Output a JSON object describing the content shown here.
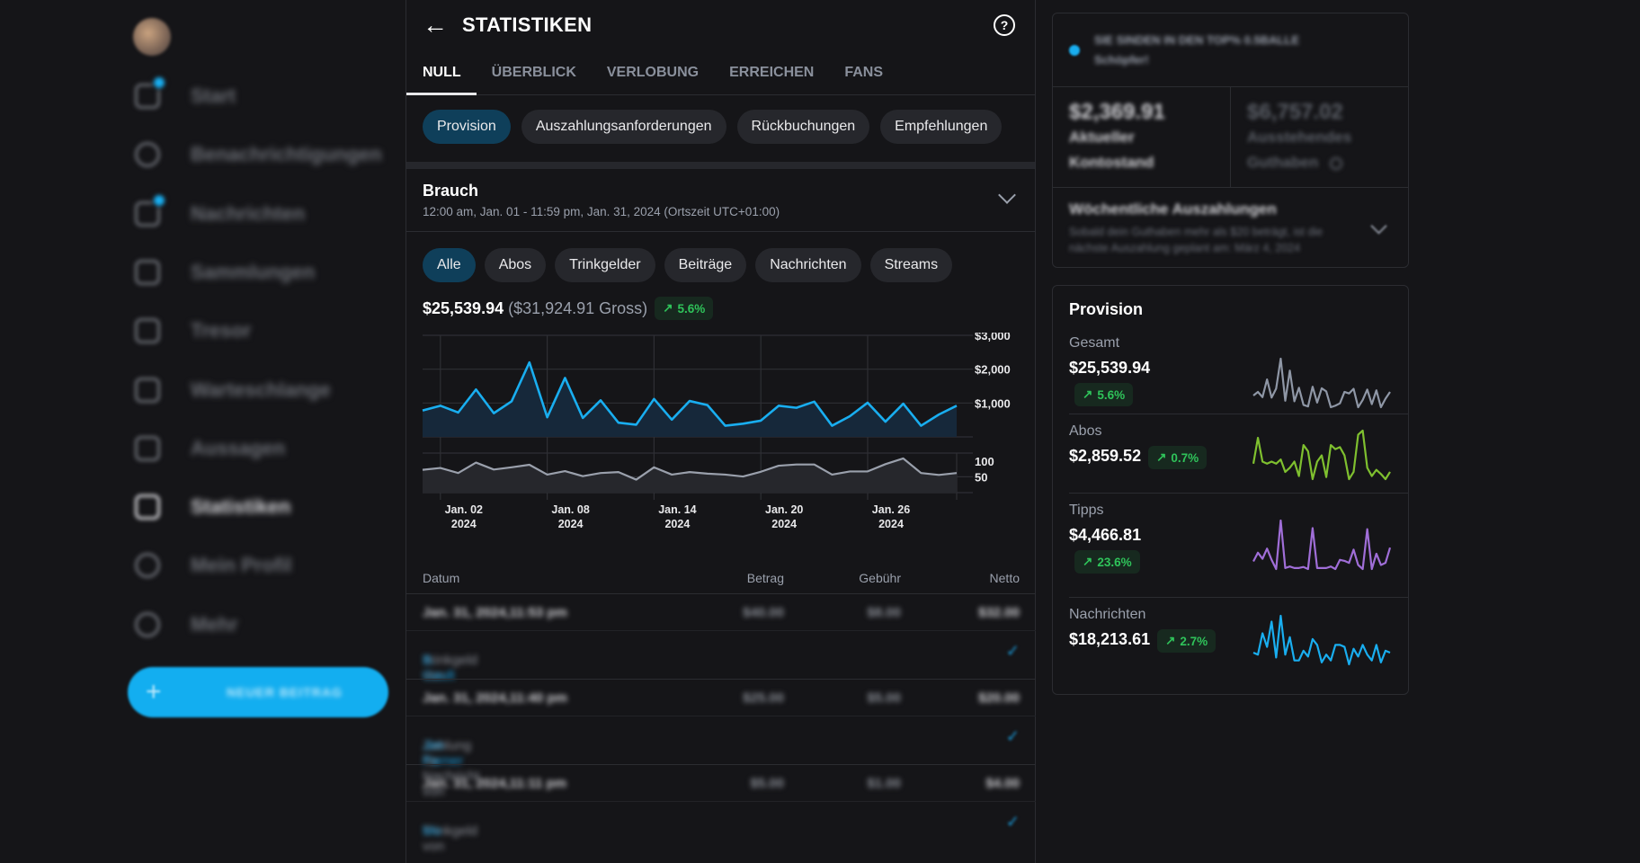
{
  "sidebar": {
    "avatar_alt": "profile avatar",
    "items": [
      {
        "label": "Start",
        "icon": "home-icon",
        "badge": true
      },
      {
        "label": "Benachrichtigungen",
        "icon": "bell-icon",
        "badge": false
      },
      {
        "label": "Nachrichten",
        "icon": "message-icon",
        "badge": true
      },
      {
        "label": "Sammlungen",
        "icon": "bookmark-icon",
        "badge": false
      },
      {
        "label": "Tresor",
        "icon": "vault-icon",
        "badge": false
      },
      {
        "label": "Warteschlange",
        "icon": "calendar-icon",
        "badge": false
      },
      {
        "label": "Aussagen",
        "icon": "statements-icon",
        "badge": false
      },
      {
        "label": "Statistiken",
        "icon": "chart-icon",
        "badge": false,
        "active": true
      },
      {
        "label": "Mein Profil",
        "icon": "profile-icon",
        "badge": false
      },
      {
        "label": "Mehr",
        "icon": "more-icon",
        "badge": false
      }
    ],
    "new_post": {
      "label": "NEUER BEITRAG",
      "icon": "+"
    }
  },
  "header": {
    "back_icon": "←",
    "title": "STATISTIKEN",
    "help_icon": "?"
  },
  "tabs": [
    {
      "label": "NULL",
      "active": true
    },
    {
      "label": "ÜBERBLICK"
    },
    {
      "label": "VERLOBUNG"
    },
    {
      "label": "ERREICHEN"
    },
    {
      "label": "FANS"
    }
  ],
  "chips": [
    {
      "label": "Provision",
      "active": true
    },
    {
      "label": "Auszahlungsanforderungen"
    },
    {
      "label": "Rückbuchungen"
    },
    {
      "label": "Empfehlungen"
    }
  ],
  "range": {
    "title": "Brauch",
    "dates": "12:00 am, Jan. 01 - 11:59 pm, Jan. 31, 2024 (Ortszeit UTC+01:00)"
  },
  "filters": [
    {
      "label": "Alle",
      "active": true
    },
    {
      "label": "Abos"
    },
    {
      "label": "Trinkgelder"
    },
    {
      "label": "Beiträge"
    },
    {
      "label": "Nachrichten"
    },
    {
      "label": "Streams"
    }
  ],
  "summary": {
    "net": "$25,539.94",
    "gross": "($31,924.91 Gross)",
    "change": "5.6%",
    "change_icon": "↗"
  },
  "chart_data": {
    "type": "line",
    "x": [
      "Jan. 01",
      "Jan. 02",
      "Jan. 03",
      "Jan. 04",
      "Jan. 05",
      "Jan. 06",
      "Jan. 07",
      "Jan. 08",
      "Jan. 09",
      "Jan. 10",
      "Jan. 11",
      "Jan. 12",
      "Jan. 13",
      "Jan. 14",
      "Jan. 15",
      "Jan. 16",
      "Jan. 17",
      "Jan. 18",
      "Jan. 19",
      "Jan. 20",
      "Jan. 21",
      "Jan. 22",
      "Jan. 23",
      "Jan. 24",
      "Jan. 25",
      "Jan. 26",
      "Jan. 27",
      "Jan. 28",
      "Jan. 29",
      "Jan. 30",
      "Jan. 31"
    ],
    "series": [
      {
        "name": "Earnings",
        "color": "#19aef0",
        "axis": "y1",
        "values": [
          780,
          920,
          720,
          1400,
          700,
          1050,
          2200,
          580,
          1740,
          560,
          1080,
          420,
          360,
          1120,
          510,
          1060,
          940,
          330,
          390,
          480,
          920,
          860,
          1040,
          330,
          610,
          1010,
          450,
          980,
          330,
          660,
          920
        ]
      },
      {
        "name": "Count",
        "color": "#9aa0ac",
        "axis": "y2",
        "values": [
          72,
          78,
          62,
          95,
          73,
          80,
          88,
          57,
          68,
          52,
          62,
          65,
          41,
          80,
          57,
          65,
          60,
          57,
          51,
          66,
          85,
          89,
          89,
          57,
          67,
          67,
          90,
          108,
          62,
          56,
          62
        ]
      }
    ],
    "x_ticks": [
      {
        "label": "Jan. 02",
        "sub": "2024",
        "index": 1
      },
      {
        "label": "Jan. 08",
        "sub": "2024",
        "index": 7
      },
      {
        "label": "Jan. 14",
        "sub": "2024",
        "index": 13
      },
      {
        "label": "Jan. 20",
        "sub": "2024",
        "index": 19
      },
      {
        "label": "Jan. 26",
        "sub": "2024",
        "index": 25
      }
    ],
    "y1_ticks": [
      {
        "label": "$3,000",
        "v": 3000
      },
      {
        "label": "$2,000",
        "v": 2000
      },
      {
        "label": "$1,000",
        "v": 1000
      }
    ],
    "y1lim": [
      0,
      3000
    ],
    "y2_ticks": [
      {
        "label": "100",
        "v": 100
      },
      {
        "label": "50",
        "v": 50
      }
    ],
    "y2lim": [
      0,
      125
    ],
    "grid": true
  },
  "table": {
    "headers": {
      "date": "Datum",
      "amount": "Betrag",
      "fee": "Gebühr",
      "net": "Netto"
    },
    "rows": [
      {
        "date": "Jan. 31, 2024,11:53 pm",
        "amount": "$40.00",
        "fee": "$8.00",
        "net": "$32.00",
        "desc": "Trinkgeld von",
        "user": "B. Gault",
        "status": "✓"
      },
      {
        "date": "Jan. 31, 2024,11:40 pm",
        "amount": "$25.00",
        "fee": "$5.00",
        "net": "$20.00",
        "desc": "Zahlung für Nachricht von",
        "user": "Jim Parner",
        "status": "✓"
      },
      {
        "date": "Jan. 31, 2024,11:11 pm",
        "amount": "$5.00",
        "fee": "$1.00",
        "net": "$4.00",
        "desc": "Trinkgeld von",
        "user": "Mo",
        "status": "✓"
      }
    ]
  },
  "right": {
    "promo": {
      "line1": "SIE SINDEN IN DEN TOP% 0.5BALLE",
      "line2": "Schöpfer!"
    },
    "current": {
      "amount": "$2,369.91",
      "label1": "Aktueller",
      "label2": "Kontostand"
    },
    "pending": {
      "amount": "$6,757.02",
      "label1": "Ausstehendes",
      "label2": "Guthaben"
    },
    "weekly": {
      "title": "Wöchentliche Auszahlungen",
      "text": "Sobald dein Guthaben mehr als $20 beträgt, ist die nächste Auszahlung geplant am: März 4, 2024"
    },
    "provision": {
      "title": "Provision",
      "rows": [
        {
          "label": "Gesamt",
          "value": "$25,539.94",
          "change": "5.6%",
          "color": "#8f97a6",
          "spark": [
            780,
            920,
            720,
            1400,
            700,
            1050,
            2200,
            580,
            1740,
            560,
            1080,
            420,
            360,
            1120,
            510,
            1060,
            940,
            330,
            390,
            480,
            920,
            860,
            1040,
            330,
            610,
            1010,
            450,
            980,
            330,
            660,
            920
          ]
        },
        {
          "label": "Abos",
          "value": "$2,859.52",
          "change": "0.7%",
          "color": "#7fc02f",
          "spark": [
            70,
            95,
            72,
            70,
            72,
            70,
            74,
            62,
            66,
            72,
            58,
            88,
            82,
            55,
            72,
            78,
            57,
            88,
            84,
            86,
            78,
            55,
            62,
            98,
            102,
            66,
            58,
            64,
            60,
            55,
            62
          ]
        },
        {
          "label": "Tipps",
          "value": "$4,466.81",
          "change": "23.6%",
          "color": "#a06ed8",
          "spark": [
            55,
            72,
            60,
            80,
            58,
            40,
            135,
            42,
            45,
            42,
            42,
            44,
            40,
            120,
            42,
            42,
            42,
            45,
            40,
            58,
            56,
            52,
            78,
            48,
            40,
            118,
            40,
            70,
            48,
            52,
            82
          ]
        },
        {
          "label": "Nachrichten",
          "value": "$18,213.61",
          "change": "2.7%",
          "color": "#19aef0",
          "spark": [
            60,
            58,
            80,
            66,
            92,
            55,
            98,
            58,
            76,
            52,
            52,
            62,
            56,
            74,
            68,
            50,
            58,
            52,
            68,
            68,
            66,
            48,
            64,
            56,
            68,
            58,
            52,
            68,
            50,
            62,
            60
          ]
        }
      ]
    }
  }
}
